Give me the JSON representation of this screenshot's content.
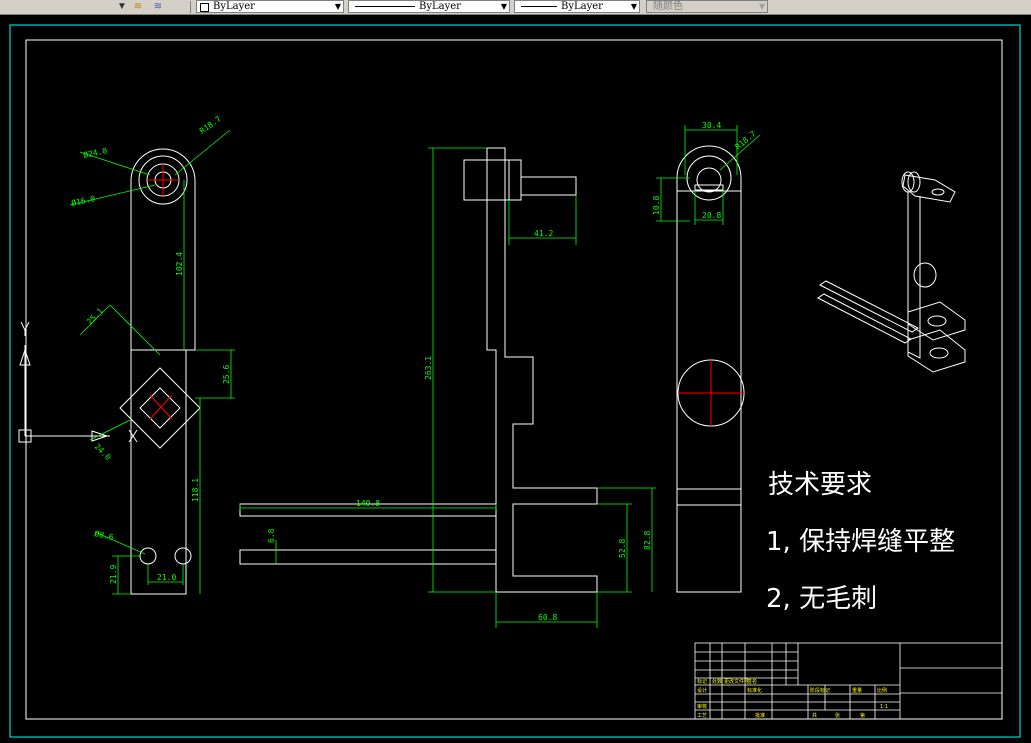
{
  "toolbar": {
    "layer_arrow": "▼",
    "color_combo": "ByLayer",
    "linetype_combo": "ByLayer",
    "lineweight_combo": "ByLayer",
    "plotstyle_combo": "随颜色"
  },
  "dimensions": {
    "d24": "Ø24.0",
    "r18": "R18.7",
    "d16": "Ø16.0",
    "len102": "102.4",
    "s25_1": "25.1",
    "s25_6": "25.6",
    "s24": "24.0",
    "len118": "118.1",
    "d8": "Ø8.6",
    "s21_0": "21.0",
    "s21_9": "21.9",
    "h263": "263.1",
    "s41": "41.2",
    "s149": "149.8",
    "s6_8": "6.8",
    "s52": "52.8",
    "s82": "82.8",
    "s60": "60.8",
    "s30": "30.4",
    "r18b": "R18.7",
    "s10": "10.8",
    "s20": "20.8"
  },
  "notes": {
    "title": "技术要求",
    "item1": "1, 保持焊缝平整",
    "item2": "2, 无毛刺"
  },
  "title_block": {
    "c1": "标记",
    "c2": "处数",
    "c3": "更改文件号",
    "c4": "签名",
    "c5": "设计",
    "c6": "标准化",
    "c7": "阶段标记",
    "c8": "重量",
    "c9": "比例",
    "c10": "审核",
    "c11": "工艺",
    "c12": "批准",
    "c13": "共",
    "c14": "张",
    "c15": "第",
    "c16": "1:1"
  },
  "colors": {
    "geometry": "#ffffff",
    "dimension": "#00ff00",
    "frame": "#00ffff",
    "center": "#ff0000",
    "text": "#ffff00"
  }
}
